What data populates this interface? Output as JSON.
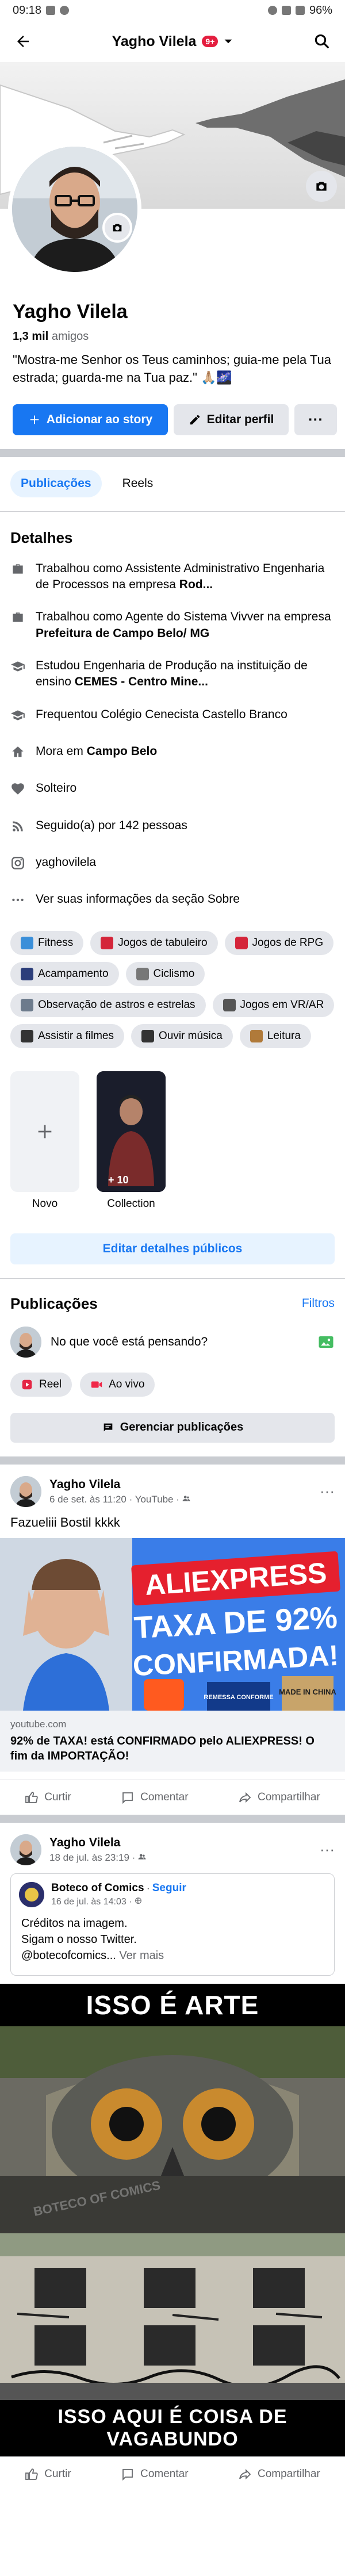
{
  "status": {
    "time": "09:18",
    "battery": "96%"
  },
  "appbar": {
    "title": "Yagho Vilela",
    "badge": "9+"
  },
  "profile": {
    "name": "Yagho Vilela",
    "friends_count": "1,3 mil",
    "friends_label": "amigos",
    "bio": "\"Mostra-me Senhor os Teus caminhos; guia-me pela Tua estrada; guarda-me na Tua paz.\" 🙏🏼🌌"
  },
  "actions": {
    "add_story": "Adicionar ao story",
    "edit_profile": "Editar perfil",
    "more": "···"
  },
  "tabs": [
    {
      "label": "Publicações"
    },
    {
      "label": "Reels"
    }
  ],
  "details": {
    "title": "Detalhes",
    "items": [
      {
        "icon": "briefcase-icon",
        "pre": "Trabalhou como Assistente Administrativo Engenharia de Processos na empresa ",
        "bold": "Rod..."
      },
      {
        "icon": "briefcase-icon",
        "pre": "Trabalhou como Agente do Sistema Vivver na empresa ",
        "bold": "Prefeitura de Campo Belo/ MG"
      },
      {
        "icon": "graduation-icon",
        "pre": "Estudou Engenharia de Produção na instituição de ensino ",
        "bold": "CEMES - Centro Mine..."
      },
      {
        "icon": "graduation-icon",
        "pre": "Frequentou Colégio Cenecista Castello Branco",
        "bold": ""
      },
      {
        "icon": "home-icon",
        "pre": "Mora em ",
        "bold": "Campo Belo"
      },
      {
        "icon": "heart-icon",
        "pre": "Solteiro",
        "bold": ""
      },
      {
        "icon": "rss-icon",
        "pre": "Seguido(a) por 142 pessoas",
        "bold": ""
      },
      {
        "icon": "instagram-icon",
        "pre": "yaghovilela",
        "bold": ""
      },
      {
        "icon": "ellipsis-icon",
        "pre": "Ver suas informações da seção Sobre",
        "bold": ""
      }
    ]
  },
  "interests": [
    {
      "label": "Fitness",
      "color": "#3b8fd9"
    },
    {
      "label": "Jogos de tabuleiro",
      "color": "#d4253a"
    },
    {
      "label": "Jogos de RPG",
      "color": "#d4253a"
    },
    {
      "label": "Acampamento",
      "color": "#2c3e7a"
    },
    {
      "label": "Ciclismo",
      "color": "#777777"
    },
    {
      "label": "Observação de astros e estrelas",
      "color": "#6d7b8c"
    },
    {
      "label": "Jogos em VR/AR",
      "color": "#555555"
    },
    {
      "label": "Assistir a filmes",
      "color": "#333333"
    },
    {
      "label": "Ouvir música",
      "color": "#333333"
    },
    {
      "label": "Leitura",
      "color": "#b07a3a"
    }
  ],
  "featured": {
    "new_label": "Novo",
    "collection_label": "Collection",
    "collection_count": "+ 10"
  },
  "edit_public": "Editar detalhes públicos",
  "publications": {
    "title": "Publicações",
    "filters": "Filtros",
    "composer_placeholder": "No que você está pensando?",
    "reel": "Reel",
    "live": "Ao vivo",
    "manage": "Gerenciar publicações"
  },
  "post1": {
    "author": "Yagho Vilela",
    "time": "6 de set. às 11:20 · YouTube · ",
    "text": "Fazueliii Bostil kkkk",
    "thumb_line1": "ALIEXPRESS",
    "thumb_line2": "TAXA DE 92%",
    "thumb_line3": "CONFIRMADA!",
    "thumb_box": "MADE IN CHINA",
    "thumb_badge": "REMESSA CONFORME",
    "domain": "youtube.com",
    "link_title": "92% de TAXA! está CONFIRMADO pelo ALIEXPRESS! O fim da IMPORTAÇÃO!"
  },
  "post_actions": {
    "like": "Curtir",
    "comment": "Comentar",
    "share": "Compartilhar"
  },
  "post2": {
    "author": "Yagho Vilela",
    "time": "18 de jul. às 23:19 · ",
    "shared_author": "Boteco of Comics",
    "follow": "Seguir",
    "shared_time": "16 de jul. às 14:03 · ",
    "shared_text": "Créditos na imagem.\nSigam o nosso Twitter.\n@botecofcomics...",
    "see_more": "Ver mais",
    "meme_top": "ISSO É ARTE",
    "meme_bottom": "ISSO AQUI É COISA DE VAGABUNDO",
    "watermark": "BOTECO OF COMICS"
  }
}
